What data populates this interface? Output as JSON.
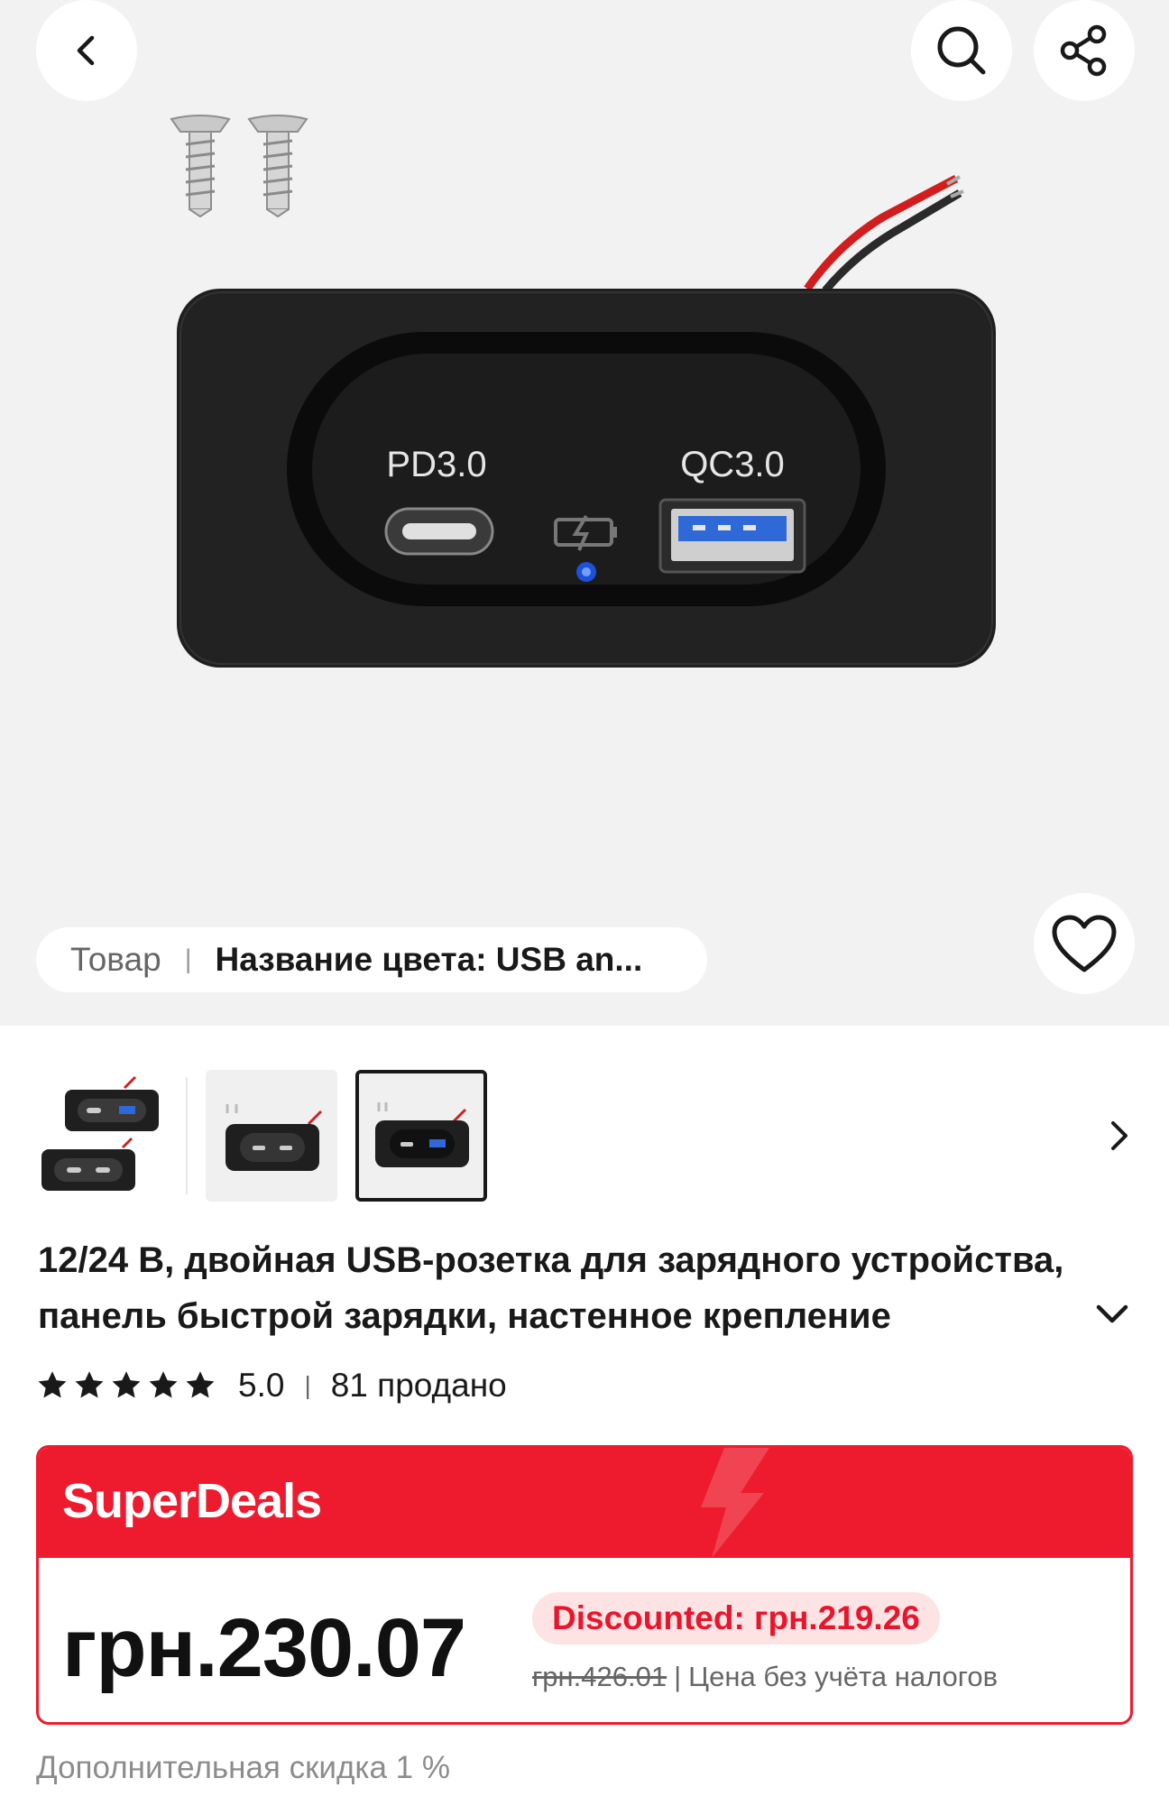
{
  "header": {
    "back_icon": "chevron-left-icon",
    "search_icon": "search-icon",
    "share_icon": "share-icon"
  },
  "product_image": {
    "port_left_label": "PD3.0",
    "port_right_label": "QC3.0"
  },
  "variant": {
    "label": "Товар",
    "separator": "|",
    "value": "Название цвета: USB an..."
  },
  "favorite_icon": "heart-outline-icon",
  "thumbnails": {
    "count": 3,
    "selected_index": 2,
    "next_icon": "chevron-right-icon"
  },
  "title": {
    "text": "12/24 В, двойная USB-розетка для зарядного устройства, панель быстрой зарядки, настенное крепление",
    "expand_icon": "chevron-down-icon"
  },
  "rating": {
    "stars": 5,
    "value": "5.0",
    "separator": "|",
    "sold": "81 продано"
  },
  "deal": {
    "brand": "SuperDeals",
    "price": "грн.230.07",
    "discounted": "Discounted: грн.219.26",
    "old_price": "грн.426.01",
    "separator": "|",
    "tax_note": "Цена без учёта налогов"
  },
  "extra_discount": "Дополнительная скидка 1 %",
  "colors": {
    "accent_red": "#ee1b2e",
    "hero_bg": "#f2f2f2",
    "text": "#191919"
  }
}
